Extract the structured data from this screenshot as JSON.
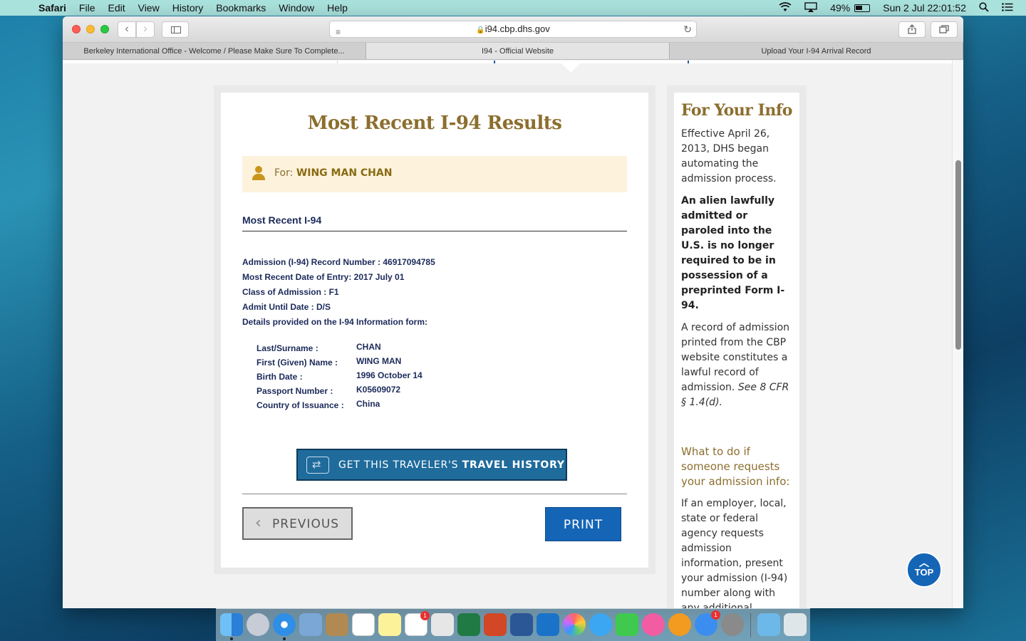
{
  "menubar": {
    "app": "Safari",
    "items": [
      "File",
      "Edit",
      "View",
      "History",
      "Bookmarks",
      "Window",
      "Help"
    ],
    "battery": "49%",
    "clock": "Sun 2 Jul  22:01:52"
  },
  "browser": {
    "url": "i94.cbp.dhs.gov",
    "tabs": [
      "Berkeley International Office - Welcome / Please Make Sure To Complete...",
      "I94 - Official Website",
      "Upload Your I-94 Arrival Record"
    ],
    "new_tab": "+"
  },
  "results": {
    "title": "Most Recent I-94 Results",
    "for_label": "For:",
    "for_name": "WING MAN CHAN",
    "section": "Most Recent I-94",
    "record_lines": [
      "Admission (I-94) Record Number : 46917094785",
      "Most Recent Date of Entry: 2017 July 01",
      "Class of Admission : F1",
      "Admit Until Date : D/S",
      "Details provided on the I-94 Information form:"
    ],
    "details": [
      {
        "label": "Last/Surname :",
        "value": "CHAN"
      },
      {
        "label": "First (Given) Name :",
        "value": "WING MAN"
      },
      {
        "label": "Birth Date :",
        "value": "1996 October 14"
      },
      {
        "label": "Passport Number :",
        "value": "K05609072"
      },
      {
        "label": "Country of Issuance :",
        "value": "China"
      }
    ],
    "travel_button_prefix": "GET THIS TRAVELER'S ",
    "travel_button_bold": "TRAVEL HISTORY",
    "previous_button": "PREVIOUS",
    "print_button": "PRINT"
  },
  "info": {
    "title": "For Your Info",
    "p1": "Effective April 26, 2013, DHS began automating the admission process.",
    "p2": "An alien lawfully admitted or paroled into the U.S. is no longer required to be in possession of a preprinted Form I-94.",
    "p3_main": "A record of admission printed from the CBP website constitutes a lawful record of admission. ",
    "p3_em": "See 8 CFR § 1.4(d).",
    "h3": "What to do if someone requests your admission info:",
    "p4": "If an employer, local, state or federal agency requests admission information, present your admission (I-94) number along with any additional"
  },
  "top_button": "TOP",
  "colors": {
    "gold": "#8c6e2e",
    "navy": "#1b2a5a",
    "blue_button": "#1565b6",
    "travel_button": "#1f6b9c",
    "menubar": "#a9e1dd"
  }
}
